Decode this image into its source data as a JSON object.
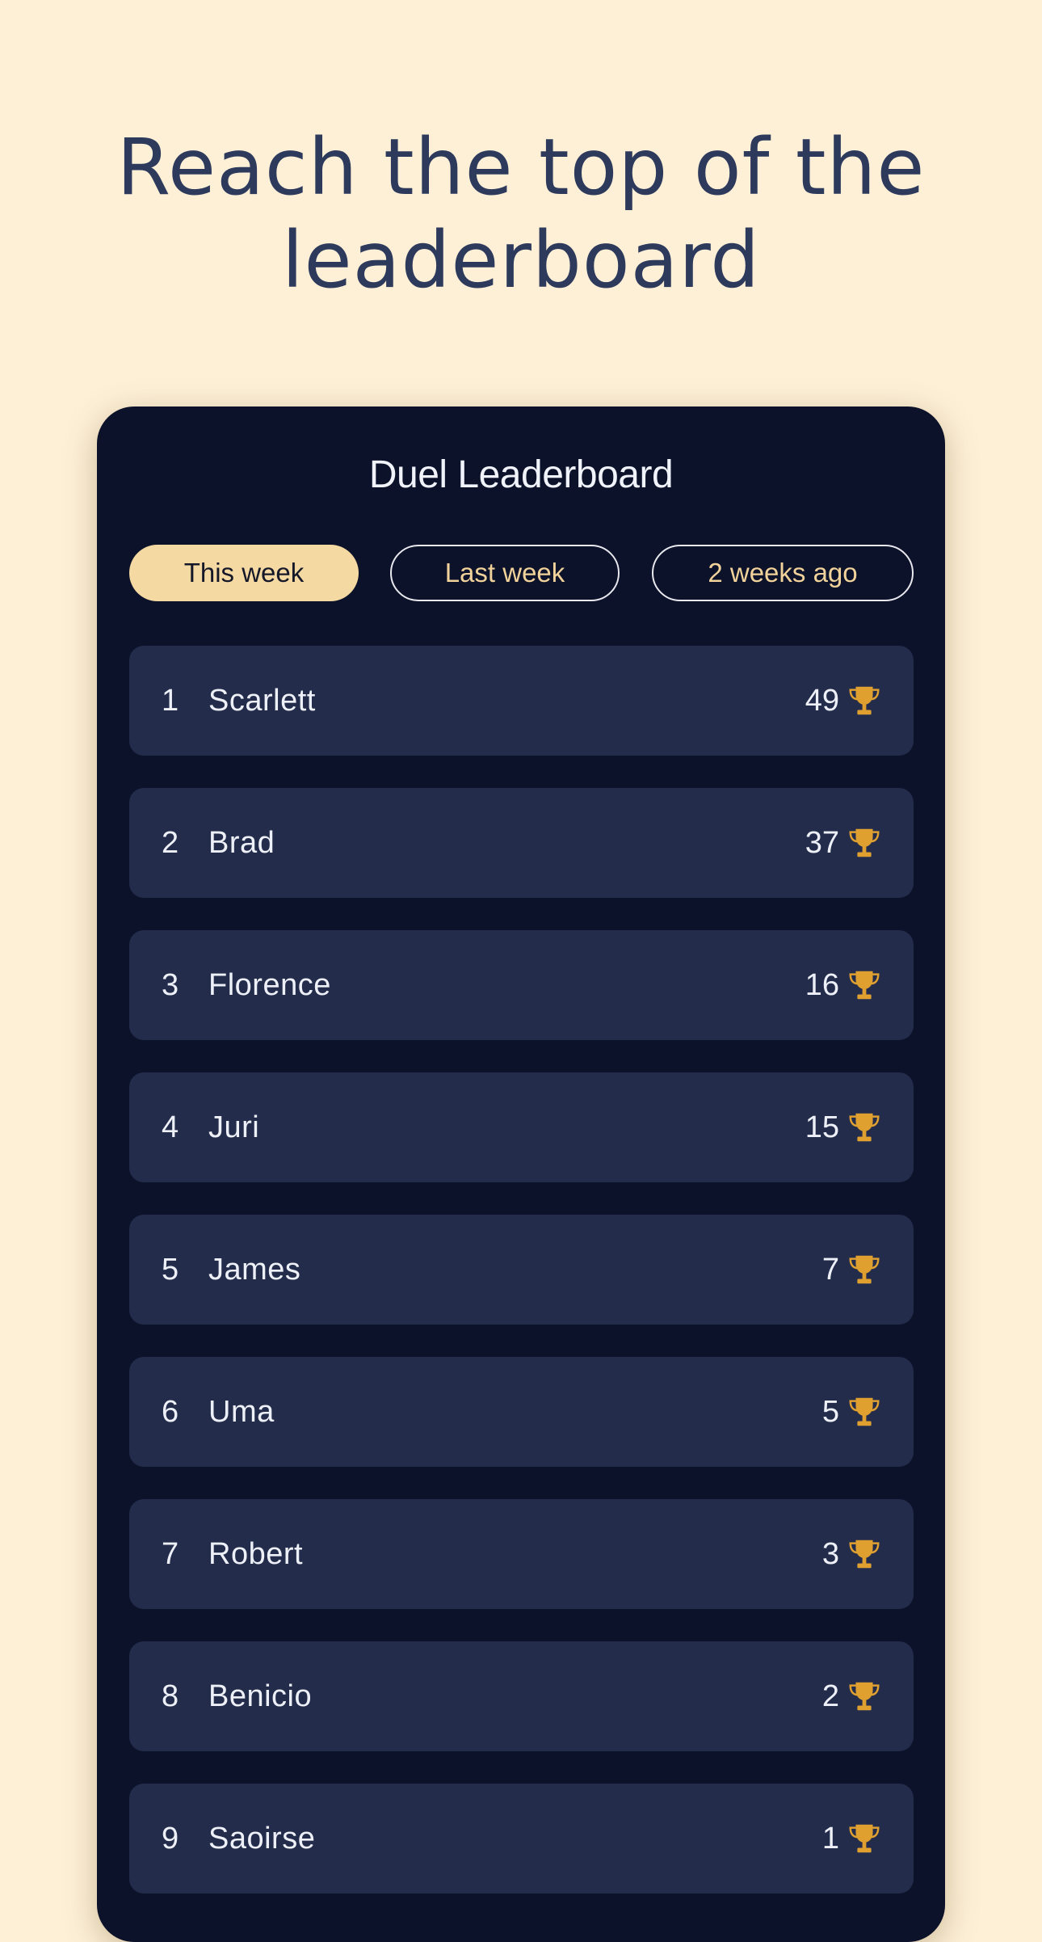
{
  "headline": {
    "line1": "Reach the top of the",
    "line2": "leaderboard"
  },
  "card": {
    "title": "Duel Leaderboard",
    "tabs": [
      {
        "label": "This week",
        "active": true
      },
      {
        "label": "Last week",
        "active": false
      },
      {
        "label": "2 weeks ago",
        "active": false
      }
    ],
    "entries": [
      {
        "rank": "1",
        "name": "Scarlett",
        "score": "49",
        "icon": "trophy-icon"
      },
      {
        "rank": "2",
        "name": "Brad",
        "score": "37",
        "icon": "trophy-icon"
      },
      {
        "rank": "3",
        "name": "Florence",
        "score": "16",
        "icon": "trophy-icon"
      },
      {
        "rank": "4",
        "name": "Juri",
        "score": "15",
        "icon": "trophy-icon"
      },
      {
        "rank": "5",
        "name": "James",
        "score": "7",
        "icon": "trophy-icon"
      },
      {
        "rank": "6",
        "name": "Uma",
        "score": "5",
        "icon": "trophy-icon"
      },
      {
        "rank": "7",
        "name": "Robert",
        "score": "3",
        "icon": "trophy-icon"
      },
      {
        "rank": "8",
        "name": "Benicio",
        "score": "2",
        "icon": "trophy-icon"
      },
      {
        "rank": "9",
        "name": "Saoirse",
        "score": "1",
        "icon": "trophy-icon"
      }
    ]
  },
  "colors": {
    "background": "#fdf0d7",
    "card": "#0c1229",
    "row": "#232d4b",
    "accent": "#f5d9a3",
    "trophy": "#e0a030",
    "headline": "#2e3a5c"
  }
}
